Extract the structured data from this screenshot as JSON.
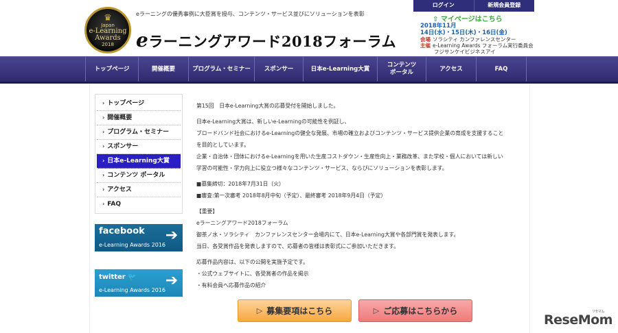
{
  "header": {
    "logo": {
      "line1": "Japan",
      "line2": "e-Learning",
      "line3": "Awards",
      "line4": "2018"
    },
    "tagline": "eラーニングの優秀事例に大臣賞を授与、コンテンツ・サービス並びにソリューションを表彰",
    "title_e": "e",
    "title_rest": "ラーニングアワード2018フォーラム",
    "login": "ログイン",
    "register": "新規会員登録",
    "mypage": "マイページはこちら",
    "event": {
      "dates": "2018年11月",
      "days": "14日(水)・15日(木)・16日(金)",
      "venue_label": "会場",
      "venue": "ソラシティ カンファレンスセンター",
      "host_label": "主催",
      "host": "e-Learning Awards フォーラム実行委員会",
      "host2": "フジサンケイビジネスアイ"
    }
  },
  "nav": [
    "トップページ",
    "開催概要",
    "プログラム・セミナー",
    "スポンサー",
    "日本e-Learning大賞",
    "コンテンツ\nポータル",
    "アクセス",
    "FAQ"
  ],
  "sidebar": {
    "items": [
      "トップページ",
      "開催概要",
      "プログラム・セミナー",
      "スポンサー",
      "日本e-Learning大賞",
      "コンテンツ ポータル",
      "アクセス",
      "FAQ"
    ],
    "facebook": {
      "title": "facebook",
      "sub": "e-Learning Awards 2016"
    },
    "twitter": {
      "title": "twitter",
      "sub": "e-Learning Awards 2016"
    }
  },
  "content": {
    "p1": "第15回　日本e-Learning大賞の応募受付を開始しました。",
    "p2a": "日本e-Learning大賞は、新しいe-Learningの可能性を例証し、",
    "p2b": "ブロードバンド社会におけるe-Learningの健全な発展、市場の確立およびコンテンツ・サービス提供企業の育成を支援すること",
    "p2c": "を目的としています。",
    "p2d": "企業・自治体・団体におけるe-Learningを用いた生産コストダウン・生産性向上・業務改革、また学校・個人においては新しい",
    "p2e": "学習の可能性・学力向上に役立つ様々なコンテンツ・サービス、ならびにソリューションを表彰します。",
    "p3a": "■募集締切：2018年7月31日（火）",
    "p3b": "■審査:第一次審考 2018年8月中旬（予定）、最終審考 2018年9月4日（予定）",
    "p4a": "【重要】",
    "p4b": "eラーニングアワード2018フォーラム",
    "p4c": "御茶ノ水・ソラシティ　カンファレンスセンター会場内にて、日本e-Learning大賞や各部門賞を発表します。",
    "p4d": "当日、各受賞作品を発表しますので、応募者の皆様は表彰式にご参加いただきます。",
    "p5a": "応募作品内容は、以下の公開を実施予定です。",
    "p5b": "・公式ウェブサイトに、各受賞者の作品を掲示",
    "p5c": "・有料会員へ応募作品の紹介"
  },
  "buttons": {
    "guidelines": "募集要項はこちら",
    "apply": "ご応募はこちらから"
  },
  "watermark": {
    "brand": "ReseMom",
    "small": "リセマム"
  }
}
